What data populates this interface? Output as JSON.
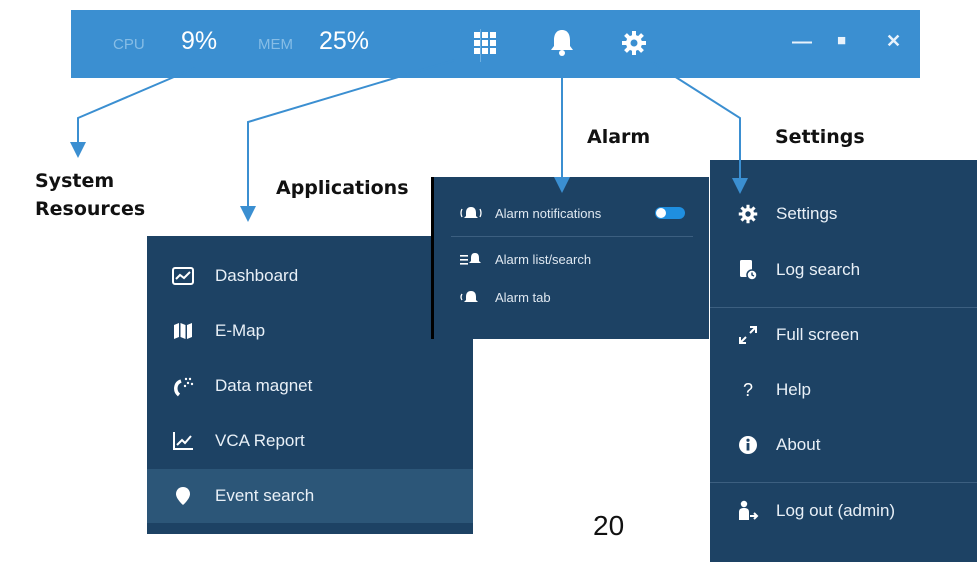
{
  "toolbar": {
    "cpu_label": "CPU",
    "cpu_value": "9%",
    "mem_label": "MEM",
    "mem_value": "25%",
    "icons": [
      "apps-grid-icon",
      "bell-icon",
      "gear-icon"
    ],
    "window_controls": {
      "minimize": "—",
      "maximize": "■",
      "close": "✕"
    },
    "color": "#3b8fd1"
  },
  "callouts": {
    "system_resources_line1": "System",
    "system_resources_line2": "Resources",
    "applications": "Applications",
    "alarm": "Alarm",
    "settings": "Settings"
  },
  "applications_menu": {
    "items": [
      {
        "label": "Dashboard",
        "icon": "dashboard-icon"
      },
      {
        "label": "E-Map",
        "icon": "map-icon"
      },
      {
        "label": "Data magnet",
        "icon": "magnet-icon"
      },
      {
        "label": "VCA Report",
        "icon": "chart-icon"
      },
      {
        "label": "Event search",
        "icon": "pin-icon",
        "active": true
      }
    ]
  },
  "alarm_menu": {
    "items": [
      {
        "label": "Alarm notifications",
        "icon": "bell-ring-icon",
        "toggle_on": true
      },
      {
        "label": "Alarm list/search",
        "icon": "alarm-list-icon"
      },
      {
        "label": "Alarm tab",
        "icon": "bell-tab-icon"
      }
    ]
  },
  "settings_menu": {
    "items": [
      {
        "label": "Settings",
        "icon": "gear-icon"
      },
      {
        "label": "Log search",
        "icon": "log-search-icon"
      },
      {
        "label": "Full screen",
        "icon": "fullscreen-icon"
      },
      {
        "label": "Help",
        "icon": "help-icon"
      },
      {
        "label": "About",
        "icon": "info-icon"
      },
      {
        "label": "Log out (admin)",
        "icon": "logout-icon"
      }
    ]
  },
  "page_number": "20",
  "colors": {
    "panel": "#1d4264",
    "active_row": "#2c5678",
    "arrow": "#3b8fd1"
  }
}
